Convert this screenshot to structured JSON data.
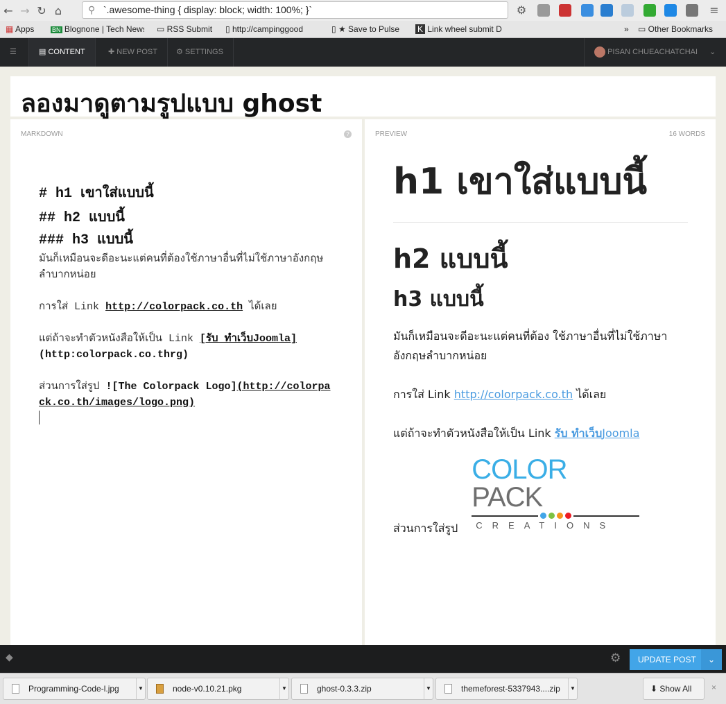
{
  "browser": {
    "url": "`.awesome-thing { display: block; width: 100%; }`",
    "bookmarks": [
      "Apps",
      "Blognone | Tech News",
      "RSS Submit",
      "http://campinggood",
      "★ Save to Pulse",
      "Link wheel submit D",
      "»",
      "Other Bookmarks"
    ]
  },
  "nav": {
    "items": [
      "CONTENT",
      "NEW POST",
      "SETTINGS"
    ],
    "user": "PISAN CHUEACHATCHAI"
  },
  "post": {
    "title": "ลองมาดูตามรูปแบบ ghost"
  },
  "markdown": {
    "label": "MARKDOWN",
    "help": "?",
    "h1": "# h1 เขาใส่แบบนี้",
    "h2": "## h2 แบบนี้",
    "h3": "### h3 แบบนี้",
    "p1": "มันก็เหมือนจะดีอะนะแต่คนที่ต้องใช้ภาษาอื่นที่ไม่ใช้ภาษาอังกฤษลำบากหน่อย",
    "p2a": "การใส่ Link ",
    "p2link": "http://colorpack.co.th",
    "p2b": " ได้เลย",
    "p3a": "แต่ถ้าจะทำตัวหนังสือให้เป็น Link ",
    "p3link": "[รับ ทำเว็บJoomla]",
    "p3url": "(http:colorpack.co.thrg)",
    "p4a": "ส่วนการใส่รูป ",
    "p4b": "![The Colorpack Logo]",
    "p4url": "(http://colorpack.co.th/images/logo.png)"
  },
  "preview": {
    "label": "PREVIEW",
    "words": "16 WORDS",
    "h1": "h1 เขาใส่แบบนี้",
    "h2": "h2 แบบนี้",
    "h3": "h3 แบบนี้",
    "p1": "มันก็เหมือนจะดีอะนะแต่คนที่ต้อง ใช้ภาษาอื่นที่ไม่ใช้ภาษาอังกฤษลำบากหน่อย",
    "p2a": "การใส่ Link ",
    "p2link": "http://colorpack.co.th",
    "p2b": " ได้เลย",
    "p3a": "แต่ถ้าจะทำตัวหนังสือให้เป็น Link ",
    "p3bold": "รับ ทำเว็บ",
    "p3link": "Joomla",
    "p4": "ส่วนการใส่รูป",
    "logo": {
      "word1": "COLOR",
      "word2": "PACK",
      "sub": "CREATIONS",
      "colors": [
        "#3aaee6",
        "#6f6f6f",
        "#42a5e8",
        "#7dc242",
        "#f7941d",
        "#ed1c24"
      ]
    }
  },
  "footer": {
    "update": "UPDATE POST",
    "accent": "#42a5e8"
  },
  "downloads": {
    "items": [
      "Programming-Code-l.jpg",
      "node-v0.10.21.pkg",
      "ghost-0.3.3.zip",
      "themeforest-5337943....zip"
    ],
    "show_all": "Show All",
    "close": "×"
  }
}
